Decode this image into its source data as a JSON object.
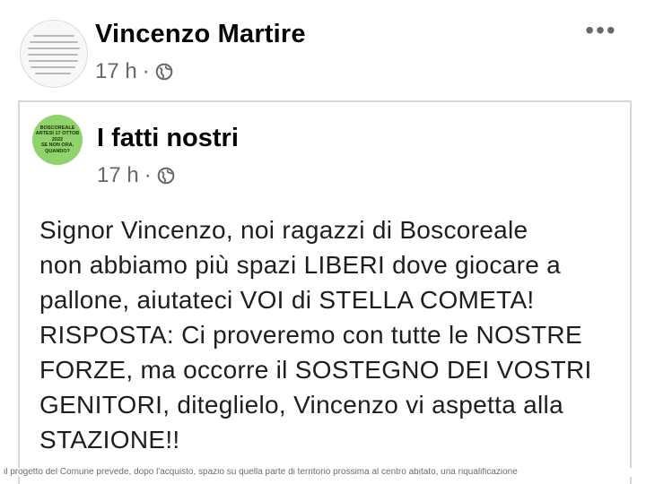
{
  "post": {
    "author": "Vincenzo Martire",
    "time": "17 h",
    "separator": "·",
    "privacy_icon": "globe-icon",
    "more_icon": "more-options-icon",
    "more_label": "•••"
  },
  "shared_post": {
    "author": "I fatti nostri",
    "time": "17 h",
    "separator": "·",
    "privacy_icon": "globe-icon",
    "avatar_lines": [
      "BOSCOREALE",
      "ARTESI 17 OTTOB",
      "2022",
      "SE NON ORA,",
      "QUANDO?"
    ],
    "avatar_color": "#8ed36b",
    "text_lines": [
      "Signor Vincenzo, noi ragazzi di Boscoreale",
      "non abbiamo più spazi LIBERI dove giocare a",
      "pallone, aiutateci VOI di STELLA COMETA!",
      "RISPOSTA: Ci proveremo con tutte le NOSTRE",
      "FORZE, ma occorre il SOSTEGNO DEI VOSTRI",
      "GENITORI, diteglielo, Vincenzo vi aspetta alla",
      "STAZIONE!!"
    ]
  },
  "footer_text": "il progetto del Comune prevede, dopo l'acquisto, spazio su quella parte di territorio prossima al centro abitato, una riqualificazione"
}
